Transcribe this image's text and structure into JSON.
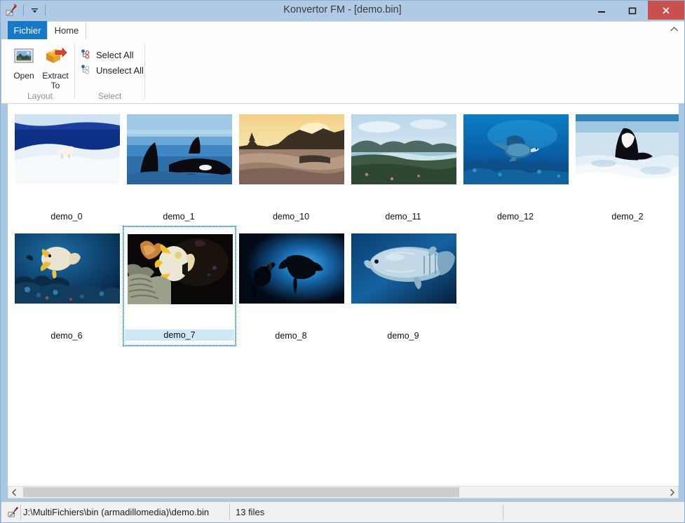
{
  "window": {
    "title": "Konvertor FM - [demo.bin]",
    "app_icon": "app-tool-icon",
    "qat": {
      "dropdown_icon": "chevron-down-icon"
    },
    "buttons": {
      "minimize": "minimize-icon",
      "maximize": "maximize-icon",
      "close": "close-icon"
    },
    "colors": {
      "titlebar": "#b0cae5",
      "frame": "#a9c6e3",
      "close_button": "#c9504f",
      "accent_tab": "#1878c8",
      "selection": "#cee8f7",
      "selection_border": "#7fbde3"
    }
  },
  "ribbon": {
    "tabs": [
      {
        "label": "Fichier",
        "active": false,
        "style": "file"
      },
      {
        "label": "Home",
        "active": true,
        "style": "normal"
      }
    ],
    "collapse_icon": "chevron-up-icon",
    "groups": [
      {
        "label": "Layout",
        "buttons": [
          {
            "label": "Open",
            "icon": "picture-frame-icon"
          },
          {
            "label": "Extract\nTo",
            "label_line1": "Extract",
            "label_line2": "To",
            "icon": "extract-box-arrow-icon"
          }
        ]
      },
      {
        "label": "Select",
        "buttons": [
          {
            "label": "Select All",
            "icon": "select-all-tree-icon"
          },
          {
            "label": "Unselect All",
            "icon": "unselect-all-tree-icon"
          }
        ]
      }
    ]
  },
  "content": {
    "thumbnails": [
      {
        "label": "demo_0",
        "selected": false,
        "art": "polar-bear-ice"
      },
      {
        "label": "demo_1",
        "selected": false,
        "art": "orcas-surface"
      },
      {
        "label": "demo_10",
        "selected": false,
        "art": "sunset-coast"
      },
      {
        "label": "demo_11",
        "selected": false,
        "art": "tropical-bay"
      },
      {
        "label": "demo_12",
        "selected": false,
        "art": "sea-turtle"
      },
      {
        "label": "demo_2",
        "selected": false,
        "art": "orca-breach"
      },
      {
        "label": "demo_6",
        "selected": false,
        "art": "angelfish-reef"
      },
      {
        "label": "demo_7",
        "selected": true,
        "art": "butterflyfish-coral"
      },
      {
        "label": "demo_8",
        "selected": false,
        "art": "manta-diver"
      },
      {
        "label": "demo_9",
        "selected": false,
        "art": "grouper-fish"
      }
    ]
  },
  "scrollbar": {
    "left_arrow_icon": "chevron-left-icon",
    "right_arrow_icon": "chevron-right-icon"
  },
  "statusbar": {
    "icon": "app-tool-icon",
    "path": "J:\\MultiFichiers\\bin (armadillomedia)\\demo.bin",
    "file_count": "13 files"
  }
}
